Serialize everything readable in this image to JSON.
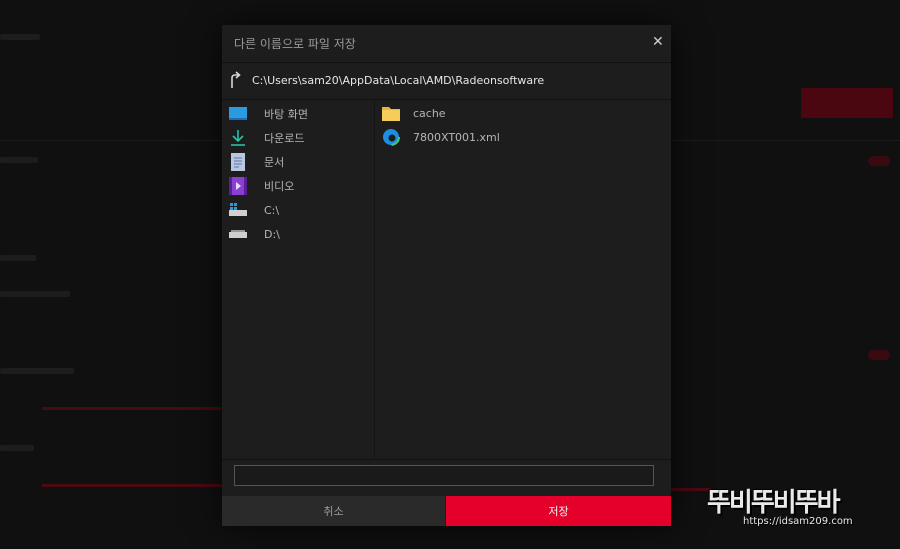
{
  "dialog": {
    "title": "다른 이름으로 파일 저장",
    "close_icon": "close-icon",
    "path": "C:\\Users\\sam20\\AppData\\Local\\AMD\\Radeonsoftware",
    "filename_value": "",
    "cancel_label": "취소",
    "save_label": "저장",
    "accent_color": "#e4002b"
  },
  "sidebar": {
    "items": [
      {
        "label": "바탕 화면",
        "icon": "desktop-icon"
      },
      {
        "label": "다운로드",
        "icon": "download-icon"
      },
      {
        "label": "문서",
        "icon": "document-icon"
      },
      {
        "label": "비디오",
        "icon": "video-icon"
      },
      {
        "label": "C:\\",
        "icon": "windows-drive-icon"
      },
      {
        "label": "D:\\",
        "icon": "drive-icon"
      }
    ]
  },
  "files": {
    "items": [
      {
        "label": "cache",
        "icon": "folder-icon"
      },
      {
        "label": "7800XT001.xml",
        "icon": "edge-browser-icon"
      }
    ]
  },
  "watermark": {
    "logo_text": "뚜비뚜비뚜바",
    "url": "https://idsam209.com"
  }
}
